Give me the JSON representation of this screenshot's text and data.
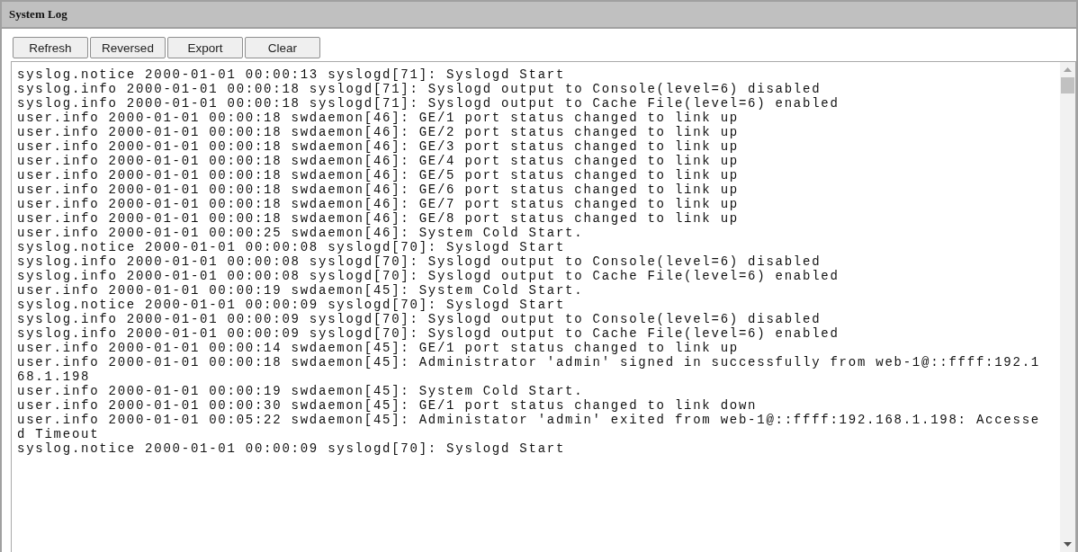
{
  "panel": {
    "title": "System Log"
  },
  "buttons": [
    {
      "label": "Refresh"
    },
    {
      "label": "Reversed"
    },
    {
      "label": "Export"
    },
    {
      "label": "Clear"
    }
  ],
  "log": {
    "entries": [
      "syslog.notice 2000-01-01 00:00:13 syslogd[71]: Syslogd Start",
      "syslog.info 2000-01-01 00:00:18 syslogd[71]: Syslogd output to Console(level=6) disabled",
      "syslog.info 2000-01-01 00:00:18 syslogd[71]: Syslogd output to Cache File(level=6) enabled",
      "user.info 2000-01-01 00:00:18 swdaemon[46]: GE/1 port status changed to link up",
      "user.info 2000-01-01 00:00:18 swdaemon[46]: GE/2 port status changed to link up",
      "user.info 2000-01-01 00:00:18 swdaemon[46]: GE/3 port status changed to link up",
      "user.info 2000-01-01 00:00:18 swdaemon[46]: GE/4 port status changed to link up",
      "user.info 2000-01-01 00:00:18 swdaemon[46]: GE/5 port status changed to link up",
      "user.info 2000-01-01 00:00:18 swdaemon[46]: GE/6 port status changed to link up",
      "user.info 2000-01-01 00:00:18 swdaemon[46]: GE/7 port status changed to link up",
      "user.info 2000-01-01 00:00:18 swdaemon[46]: GE/8 port status changed to link up",
      "user.info 2000-01-01 00:00:25 swdaemon[46]: System Cold Start.",
      "syslog.notice 2000-01-01 00:00:08 syslogd[70]: Syslogd Start",
      "syslog.info 2000-01-01 00:00:08 syslogd[70]: Syslogd output to Console(level=6) disabled",
      "syslog.info 2000-01-01 00:00:08 syslogd[70]: Syslogd output to Cache File(level=6) enabled",
      "user.info 2000-01-01 00:00:19 swdaemon[45]: System Cold Start.",
      "syslog.notice 2000-01-01 00:00:09 syslogd[70]: Syslogd Start",
      "syslog.info 2000-01-01 00:00:09 syslogd[70]: Syslogd output to Console(level=6) disabled",
      "syslog.info 2000-01-01 00:00:09 syslogd[70]: Syslogd output to Cache File(level=6) enabled",
      "user.info 2000-01-01 00:00:14 swdaemon[45]: GE/1 port status changed to link up",
      "user.info 2000-01-01 00:00:18 swdaemon[45]: Administrator 'admin' signed in successfully from web-1@::ffff:192.168.1.198",
      "user.info 2000-01-01 00:00:19 swdaemon[45]: System Cold Start.",
      "user.info 2000-01-01 00:00:30 swdaemon[45]: GE/1 port status changed to link down",
      "user.info 2000-01-01 00:05:22 swdaemon[45]: Administator 'admin' exited from web-1@::ffff:192.168.1.198: Accessed Timeout",
      "syslog.notice 2000-01-01 00:00:09 syslogd[70]: Syslogd Start"
    ]
  }
}
